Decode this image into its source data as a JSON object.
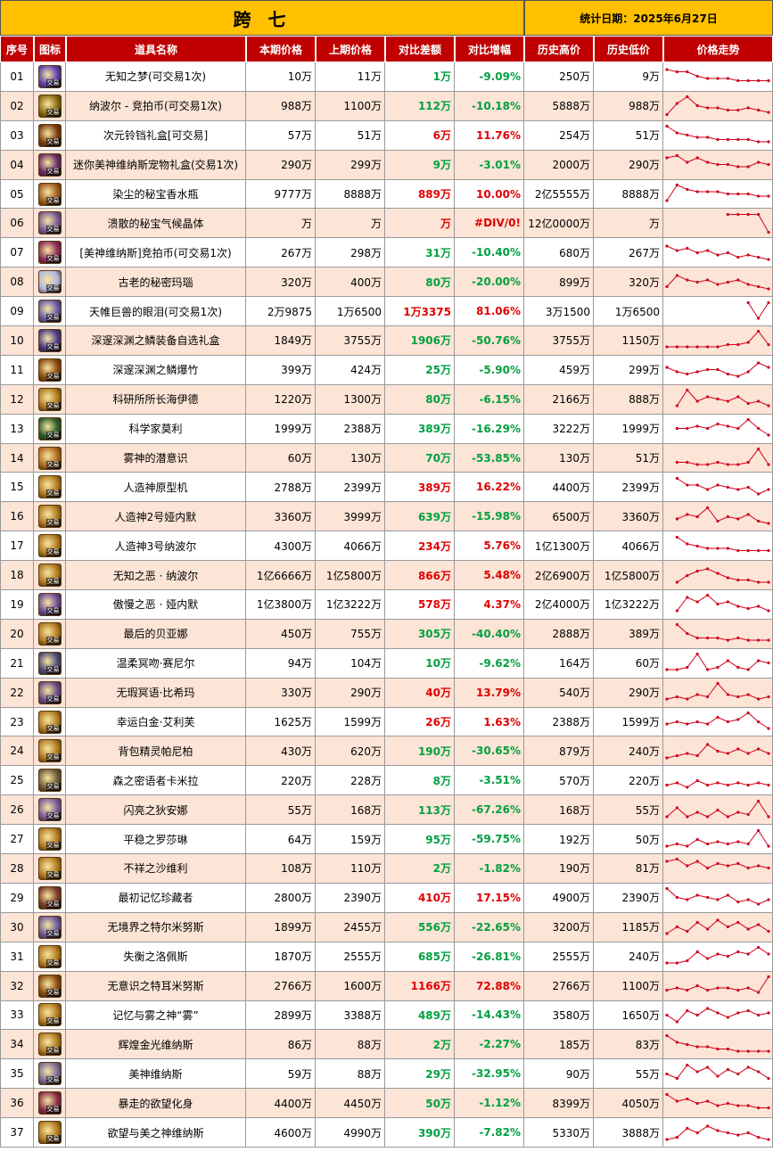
{
  "title": "跨 七",
  "date_label": "统计日期：2025年6月27日",
  "columns": [
    "序号",
    "图标",
    "道具名称",
    "本期价格",
    "上期价格",
    "对比差额",
    "对比增幅",
    "历史高价",
    "历史低价",
    "价格走势"
  ],
  "icon_tag": "交易",
  "colors": {
    "up": "#e00000",
    "down": "#00a040",
    "header": "#c00000",
    "title": "#ffc000",
    "alt_row": "#fce4d6",
    "trend": "#d0021b"
  },
  "rows": [
    {
      "no": "01",
      "name": "无知之梦(可交易1次)",
      "cur": "10万",
      "prev": "11万",
      "diff": "1万",
      "pct": "-9.09%",
      "dir": "down",
      "hi": "250万",
      "lo": "9万",
      "icon": "purple-orb-icon",
      "color": "#5a3fb0",
      "trend": [
        8,
        7,
        7,
        5,
        4,
        4,
        4,
        3,
        3,
        3,
        3
      ]
    },
    {
      "no": "02",
      "name": "纳波尔 - 竞拍币(可交易1次)",
      "cur": "988万",
      "prev": "1100万",
      "diff": "112万",
      "pct": "-10.18%",
      "dir": "down",
      "hi": "5888万",
      "lo": "988万",
      "icon": "coin-icon",
      "color": "#8a6a10",
      "trend": [
        1,
        6,
        9,
        5,
        4,
        4,
        3,
        3,
        4,
        3,
        2
      ]
    },
    {
      "no": "03",
      "name": "次元铃铛礼盒[可交易]",
      "cur": "57万",
      "prev": "51万",
      "diff": "6万",
      "pct": "11.76%",
      "dir": "up",
      "hi": "254万",
      "lo": "51万",
      "icon": "bell-box-icon",
      "color": "#7a3a10",
      "trend": [
        9,
        6,
        5,
        4,
        4,
        3,
        3,
        3,
        3,
        2,
        2
      ]
    },
    {
      "no": "04",
      "name": "迷你美神维纳斯宠物礼盒(交易1次)",
      "cur": "290万",
      "prev": "299万",
      "diff": "9万",
      "pct": "-3.01%",
      "dir": "down",
      "hi": "2000万",
      "lo": "290万",
      "icon": "pet-box-icon",
      "color": "#6a2a6a",
      "trend": [
        8,
        9,
        6,
        8,
        6,
        5,
        5,
        4,
        4,
        6,
        5
      ]
    },
    {
      "no": "05",
      "name": "染尘的秘宝香水瓶",
      "cur": "9777万",
      "prev": "8888万",
      "diff": "889万",
      "pct": "10.00%",
      "dir": "up",
      "hi": "2亿5555万",
      "lo": "8888万",
      "icon": "perfume-icon",
      "color": "#a05a20",
      "trend": [
        2,
        9,
        7,
        6,
        6,
        6,
        5,
        5,
        5,
        4,
        4
      ]
    },
    {
      "no": "06",
      "name": "溃散的秘宝气候晶体",
      "cur": "万",
      "prev": "万",
      "diff": "万",
      "pct": "#DIV/0!",
      "dir": "up",
      "hi": "12亿0000万",
      "lo": "万",
      "icon": "crystal-icon",
      "color": "#7a5a9a",
      "trend": [
        null,
        null,
        null,
        null,
        null,
        null,
        9,
        9,
        9,
        9,
        1
      ]
    },
    {
      "no": "07",
      "name": "[美神维纳斯]竞拍币(可交易1次)",
      "cur": "267万",
      "prev": "298万",
      "diff": "31万",
      "pct": "-10.40%",
      "dir": "down",
      "hi": "680万",
      "lo": "267万",
      "icon": "auction-coin-icon",
      "color": "#8a2a5a",
      "trend": [
        8,
        6,
        7,
        5,
        6,
        4,
        5,
        3,
        4,
        3,
        2
      ]
    },
    {
      "no": "08",
      "name": "古老的秘密玛瑙",
      "cur": "320万",
      "prev": "400万",
      "diff": "80万",
      "pct": "-20.00%",
      "dir": "down",
      "hi": "899万",
      "lo": "320万",
      "icon": "agate-icon",
      "color": "#b0b8e0",
      "trend": [
        3,
        8,
        6,
        5,
        6,
        4,
        5,
        6,
        4,
        3,
        2
      ]
    },
    {
      "no": "09",
      "name": "天帷巨兽的眼泪(可交易1次)",
      "cur": "2万9875",
      "prev": "1万6500",
      "diff": "1万3375",
      "pct": "81.06%",
      "dir": "up",
      "hi": "3万1500",
      "lo": "1万6500",
      "icon": "tear-icon",
      "color": "#6a5ab0",
      "trend": [
        null,
        null,
        null,
        null,
        null,
        null,
        null,
        null,
        9,
        2,
        9
      ]
    },
    {
      "no": "10",
      "name": "深邃深渊之鳞装备自选礼盒",
      "cur": "1849万",
      "prev": "3755万",
      "diff": "1906万",
      "pct": "-50.76%",
      "dir": "down",
      "hi": "3755万",
      "lo": "1150万",
      "icon": "abyss-box-icon",
      "color": "#4a3a8a",
      "trend": [
        2,
        2,
        2,
        2,
        2,
        2,
        3,
        3,
        4,
        9,
        3
      ]
    },
    {
      "no": "11",
      "name": "深邃深渊之鳞爆竹",
      "cur": "399万",
      "prev": "424万",
      "diff": "25万",
      "pct": "-5.90%",
      "dir": "down",
      "hi": "459万",
      "lo": "299万",
      "icon": "firecracker-icon",
      "color": "#8a4a10",
      "trend": [
        6,
        4,
        3,
        4,
        5,
        5,
        3,
        2,
        4,
        8,
        6
      ]
    },
    {
      "no": "12",
      "name": "科研所所长海伊德",
      "cur": "1220万",
      "prev": "1300万",
      "diff": "80万",
      "pct": "-6.15%",
      "dir": "down",
      "hi": "2166万",
      "lo": "888万",
      "icon": "card-icon",
      "color": "#b07a20",
      "trend": [
        null,
        2,
        9,
        4,
        6,
        5,
        4,
        6,
        3,
        4,
        2
      ]
    },
    {
      "no": "13",
      "name": "科学家莫利",
      "cur": "1999万",
      "prev": "2388万",
      "diff": "389万",
      "pct": "-16.29%",
      "dir": "down",
      "hi": "3222万",
      "lo": "1999万",
      "icon": "card-icon",
      "color": "#2a5a2a",
      "trend": [
        null,
        5,
        5,
        6,
        5,
        7,
        6,
        5,
        9,
        5,
        2
      ]
    },
    {
      "no": "14",
      "name": "雾神的潜意识",
      "cur": "60万",
      "prev": "130万",
      "diff": "70万",
      "pct": "-53.85%",
      "dir": "down",
      "hi": "130万",
      "lo": "51万",
      "icon": "card-icon",
      "color": "#b06a20",
      "trend": [
        null,
        3,
        3,
        2,
        2,
        3,
        2,
        2,
        3,
        9,
        2
      ]
    },
    {
      "no": "15",
      "name": "人造神原型机",
      "cur": "2788万",
      "prev": "2399万",
      "diff": "389万",
      "pct": "16.22%",
      "dir": "up",
      "hi": "4400万",
      "lo": "2399万",
      "icon": "card-icon",
      "color": "#b07a20",
      "trend": [
        null,
        9,
        6,
        6,
        4,
        6,
        5,
        4,
        5,
        2,
        4
      ]
    },
    {
      "no": "16",
      "name": "人造神2号娅内默",
      "cur": "3360万",
      "prev": "3999万",
      "diff": "639万",
      "pct": "-15.98%",
      "dir": "down",
      "hi": "6500万",
      "lo": "3360万",
      "icon": "card-icon",
      "color": "#b07a20",
      "trend": [
        null,
        4,
        6,
        5,
        9,
        3,
        5,
        4,
        6,
        3,
        2
      ]
    },
    {
      "no": "17",
      "name": "人造神3号纳波尔",
      "cur": "4300万",
      "prev": "4066万",
      "diff": "234万",
      "pct": "5.76%",
      "dir": "up",
      "hi": "1亿1300万",
      "lo": "4066万",
      "icon": "card-icon",
      "color": "#b07a20",
      "trend": [
        null,
        9,
        6,
        5,
        4,
        4,
        4,
        3,
        3,
        3,
        3
      ]
    },
    {
      "no": "18",
      "name": "无知之恶 · 纳波尔",
      "cur": "1亿6666万",
      "prev": "1亿5800万",
      "diff": "866万",
      "pct": "5.48%",
      "dir": "up",
      "hi": "2亿6900万",
      "lo": "1亿5800万",
      "icon": "card-icon",
      "color": "#b07a20",
      "trend": [
        null,
        2,
        5,
        7,
        8,
        6,
        4,
        3,
        3,
        2,
        2
      ]
    },
    {
      "no": "19",
      "name": "傲慢之恶 · 娅内默",
      "cur": "1亿3800万",
      "prev": "1亿3222万",
      "diff": "578万",
      "pct": "4.37%",
      "dir": "up",
      "hi": "2亿4000万",
      "lo": "1亿3222万",
      "icon": "card-icon",
      "color": "#6a4a9a",
      "trend": [
        null,
        2,
        8,
        6,
        9,
        5,
        6,
        4,
        3,
        4,
        2
      ]
    },
    {
      "no": "20",
      "name": "最后的贝亚娜",
      "cur": "450万",
      "prev": "755万",
      "diff": "305万",
      "pct": "-40.40%",
      "dir": "down",
      "hi": "2888万",
      "lo": "389万",
      "icon": "card-icon",
      "color": "#b07a20",
      "trend": [
        null,
        9,
        5,
        3,
        3,
        3,
        2,
        3,
        2,
        2,
        2
      ]
    },
    {
      "no": "21",
      "name": "温柔冥吻·赛尼尔",
      "cur": "94万",
      "prev": "104万",
      "diff": "10万",
      "pct": "-9.62%",
      "dir": "down",
      "hi": "164万",
      "lo": "60万",
      "icon": "card-icon",
      "color": "#4a4a7a",
      "trend": [
        2,
        2,
        3,
        9,
        2,
        3,
        6,
        3,
        2,
        6,
        5
      ]
    },
    {
      "no": "22",
      "name": "无瑕冥语·比希玛",
      "cur": "330万",
      "prev": "290万",
      "diff": "40万",
      "pct": "13.79%",
      "dir": "up",
      "hi": "540万",
      "lo": "290万",
      "icon": "card-icon",
      "color": "#6a4a8a",
      "trend": [
        2,
        3,
        2,
        4,
        3,
        9,
        4,
        3,
        4,
        2,
        3
      ]
    },
    {
      "no": "23",
      "name": "幸运白金·艾利芙",
      "cur": "1625万",
      "prev": "1599万",
      "diff": "26万",
      "pct": "1.63%",
      "dir": "up",
      "hi": "2388万",
      "lo": "1599万",
      "icon": "card-icon",
      "color": "#b07a20",
      "trend": [
        4,
        5,
        4,
        5,
        4,
        7,
        5,
        6,
        9,
        5,
        2
      ]
    },
    {
      "no": "24",
      "name": "背包精灵帕尼柏",
      "cur": "430万",
      "prev": "620万",
      "diff": "190万",
      "pct": "-30.65%",
      "dir": "down",
      "hi": "879万",
      "lo": "240万",
      "icon": "card-icon",
      "color": "#b07a20",
      "trend": [
        2,
        3,
        4,
        3,
        8,
        5,
        4,
        6,
        4,
        6,
        4
      ]
    },
    {
      "no": "25",
      "name": "森之密语者卡米拉",
      "cur": "220万",
      "prev": "228万",
      "diff": "8万",
      "pct": "-3.51%",
      "dir": "down",
      "hi": "570万",
      "lo": "220万",
      "icon": "card-icon",
      "color": "#6a5a3a",
      "trend": [
        3,
        4,
        2,
        5,
        3,
        4,
        3,
        4,
        3,
        4,
        3
      ]
    },
    {
      "no": "26",
      "name": "闪亮之狄安娜",
      "cur": "55万",
      "prev": "168万",
      "diff": "113万",
      "pct": "-67.26%",
      "dir": "down",
      "hi": "168万",
      "lo": "55万",
      "icon": "card-icon",
      "color": "#7a5aa0",
      "trend": [
        2,
        6,
        2,
        4,
        2,
        5,
        2,
        4,
        3,
        9,
        2
      ]
    },
    {
      "no": "27",
      "name": "平稳之罗莎琳",
      "cur": "64万",
      "prev": "159万",
      "diff": "95万",
      "pct": "-59.75%",
      "dir": "down",
      "hi": "192万",
      "lo": "50万",
      "icon": "card-icon",
      "color": "#b07a20",
      "trend": [
        2,
        3,
        2,
        5,
        3,
        4,
        3,
        4,
        3,
        9,
        2
      ]
    },
    {
      "no": "28",
      "name": "不祥之沙维利",
      "cur": "108万",
      "prev": "110万",
      "diff": "2万",
      "pct": "-1.82%",
      "dir": "down",
      "hi": "190万",
      "lo": "81万",
      "icon": "card-icon",
      "color": "#b07a20",
      "trend": [
        8,
        9,
        6,
        8,
        5,
        7,
        6,
        7,
        5,
        6,
        5
      ]
    },
    {
      "no": "29",
      "name": "最初记忆珍藏者",
      "cur": "2800万",
      "prev": "2390万",
      "diff": "410万",
      "pct": "17.15%",
      "dir": "up",
      "hi": "4900万",
      "lo": "2390万",
      "icon": "card-icon",
      "color": "#7a3a2a",
      "trend": [
        9,
        5,
        4,
        6,
        5,
        4,
        6,
        3,
        4,
        2,
        4
      ]
    },
    {
      "no": "30",
      "name": "无境界之特尔米努斯",
      "cur": "1899万",
      "prev": "2455万",
      "diff": "556万",
      "pct": "-22.65%",
      "dir": "down",
      "hi": "3200万",
      "lo": "1185万",
      "icon": "card-icon",
      "color": "#6a5a9a",
      "trend": [
        2,
        5,
        3,
        7,
        4,
        8,
        5,
        7,
        4,
        6,
        3
      ]
    },
    {
      "no": "31",
      "name": "失衡之洛佩斯",
      "cur": "1870万",
      "prev": "2555万",
      "diff": "685万",
      "pct": "-26.81%",
      "dir": "down",
      "hi": "2555万",
      "lo": "240万",
      "icon": "card-icon",
      "color": "#b07a20",
      "trend": [
        2,
        2,
        3,
        7,
        4,
        6,
        5,
        7,
        6,
        9,
        6
      ]
    },
    {
      "no": "32",
      "name": "无意识之特耳米努斯",
      "cur": "2766万",
      "prev": "1600万",
      "diff": "1166万",
      "pct": "72.88%",
      "dir": "up",
      "hi": "2766万",
      "lo": "1100万",
      "icon": "card-icon",
      "color": "#8a4a10",
      "trend": [
        3,
        4,
        3,
        5,
        3,
        4,
        4,
        3,
        4,
        2,
        9
      ]
    },
    {
      "no": "33",
      "name": "记忆与雾之神“雾”",
      "cur": "2899万",
      "prev": "3388万",
      "diff": "489万",
      "pct": "-14.43%",
      "dir": "down",
      "hi": "3580万",
      "lo": "1650万",
      "icon": "card-icon",
      "color": "#b07a20",
      "trend": [
        5,
        2,
        7,
        5,
        8,
        6,
        4,
        6,
        7,
        5,
        6
      ]
    },
    {
      "no": "34",
      "name": "辉煌金光维纳斯",
      "cur": "86万",
      "prev": "88万",
      "diff": "2万",
      "pct": "-2.27%",
      "dir": "down",
      "hi": "185万",
      "lo": "83万",
      "icon": "card-icon",
      "color": "#b07a20",
      "trend": [
        9,
        6,
        5,
        4,
        4,
        3,
        3,
        2,
        2,
        2,
        2
      ]
    },
    {
      "no": "35",
      "name": "美神维纳斯",
      "cur": "59万",
      "prev": "88万",
      "diff": "29万",
      "pct": "-32.95%",
      "dir": "down",
      "hi": "90万",
      "lo": "55万",
      "icon": "card-icon",
      "color": "#7a6a9a",
      "trend": [
        5,
        3,
        9,
        6,
        8,
        4,
        7,
        5,
        8,
        6,
        3
      ]
    },
    {
      "no": "36",
      "name": "暴走的欲望化身",
      "cur": "4400万",
      "prev": "4450万",
      "diff": "50万",
      "pct": "-1.12%",
      "dir": "down",
      "hi": "8399万",
      "lo": "4050万",
      "icon": "card-icon",
      "color": "#8a2a4a",
      "trend": [
        9,
        6,
        7,
        5,
        6,
        4,
        5,
        4,
        4,
        3,
        3
      ]
    },
    {
      "no": "37",
      "name": "欲望与美之神维纳斯",
      "cur": "4600万",
      "prev": "4990万",
      "diff": "390万",
      "pct": "-7.82%",
      "dir": "down",
      "hi": "5330万",
      "lo": "3888万",
      "icon": "card-icon",
      "color": "#b07a20",
      "trend": [
        2,
        3,
        7,
        5,
        8,
        6,
        5,
        4,
        5,
        3,
        2
      ]
    }
  ]
}
